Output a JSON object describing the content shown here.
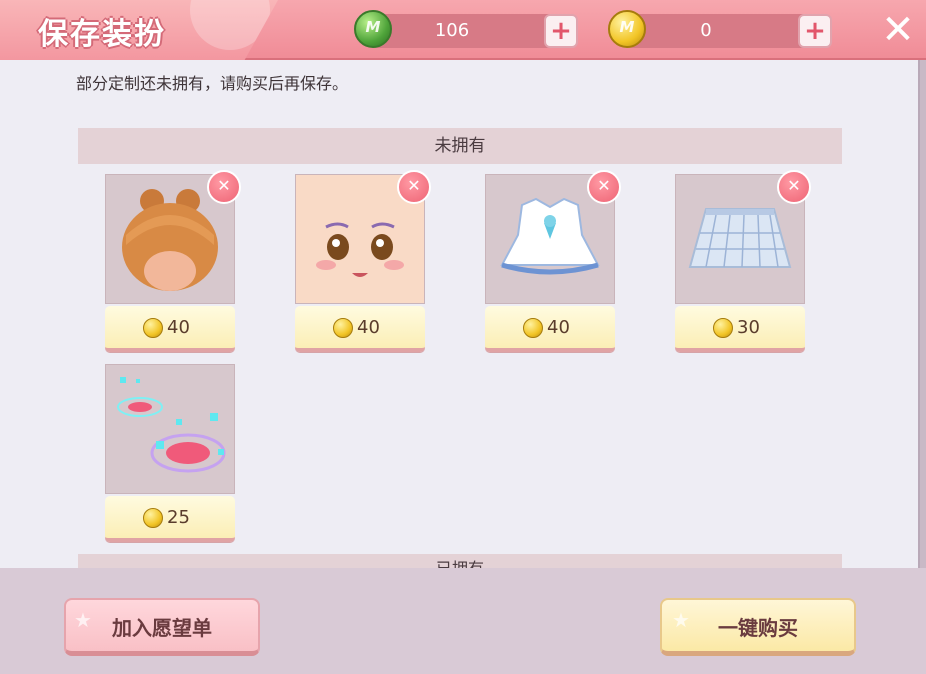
{
  "header": {
    "title": "保存装扮",
    "gem_balance": "106",
    "gold_balance": "0",
    "gem_icon_mark": "M",
    "gold_icon_mark": "M",
    "plus_symbol": "+",
    "close_symbol": "✕"
  },
  "notice": "部分定制还未拥有，请购买后再保存。",
  "sections": {
    "unowned_title": "未拥有",
    "owned_title": "已拥有"
  },
  "items": [
    {
      "name": "hair",
      "price": "40",
      "icon": "hair-bun-icon"
    },
    {
      "name": "face",
      "price": "40",
      "icon": "face-icon"
    },
    {
      "name": "dress",
      "price": "40",
      "icon": "dress-icon"
    },
    {
      "name": "skirt",
      "price": "30",
      "icon": "plaid-skirt-icon"
    },
    {
      "name": "effect",
      "price": "25",
      "icon": "magic-circle-effect-icon"
    }
  ],
  "remove_symbol": "✕",
  "buttons": {
    "wishlist": "加入愿望单",
    "buy_all": "一键购买"
  },
  "colors": {
    "header": "#f08c97",
    "panel": "#eeedf4",
    "section_header": "#e4d2d6",
    "price_tag": "#fbeeb6",
    "remove_button": "#ee6374"
  }
}
